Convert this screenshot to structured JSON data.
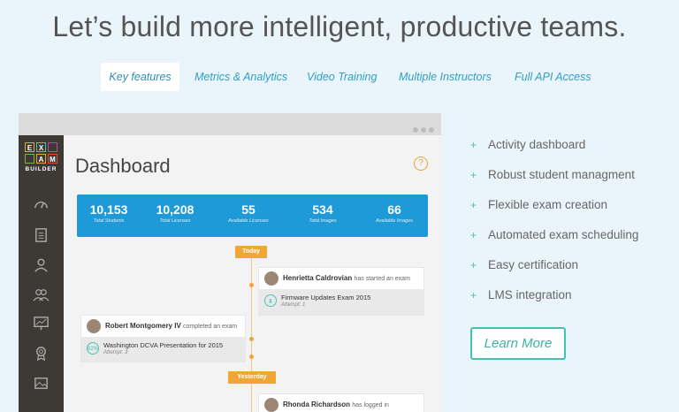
{
  "headline": "Let’s build more intelligent, productive teams.",
  "tabs": [
    {
      "label": "Key features",
      "active": true
    },
    {
      "label": "Metrics & Analytics"
    },
    {
      "label": "Video Training"
    },
    {
      "label": "Multiple Instructors"
    },
    {
      "label": "Full API Access"
    }
  ],
  "logo": {
    "letters": [
      "E",
      "X",
      "A",
      "M"
    ],
    "word": "BUILDER"
  },
  "sidebar_icons": [
    "dashboard-icon",
    "clipboard-icon",
    "user-icon",
    "users-icon",
    "chart-icon",
    "certificate-icon",
    "image-icon"
  ],
  "dashboard": {
    "title": "Dashboard",
    "help_glyph": "?",
    "stats": [
      {
        "value": "10,153",
        "label": "Total Students"
      },
      {
        "value": "10,208",
        "label": "Total Licenses"
      },
      {
        "value": "55",
        "label": "Available Licenses"
      },
      {
        "value": "534",
        "label": "Total Images"
      },
      {
        "value": "66",
        "label": "Available Images"
      }
    ],
    "badges": {
      "today": "Today",
      "yesterday": "Yesterday"
    },
    "cards": [
      {
        "name": "Henrietta Caldrovian",
        "action": "has started an exam",
        "exam": "Firmware Updates Exam 2015",
        "attempt": "Attempt: 1",
        "icon": "hourglass-icon"
      },
      {
        "name": "Robert Montgomery IV",
        "action": "completed an exam",
        "exam": "Washington DCVA Presentation for 2015",
        "attempt": "Attempt: 3",
        "score": "82%",
        "icon": "score-icon"
      },
      {
        "name": "Rhonda Richardson",
        "action": "has logged in"
      }
    ]
  },
  "features": [
    "Activity dashboard",
    "Robust student managment",
    "Flexible exam creation",
    "Automated exam scheduling",
    "Easy certification",
    "LMS integration"
  ],
  "plus_glyph": "+",
  "learn_more": "Learn More",
  "colors": {
    "accent": "#1d9ad7",
    "teal": "#45c0b2",
    "orange": "#f0a634",
    "sidebar": "#3d3a36"
  }
}
